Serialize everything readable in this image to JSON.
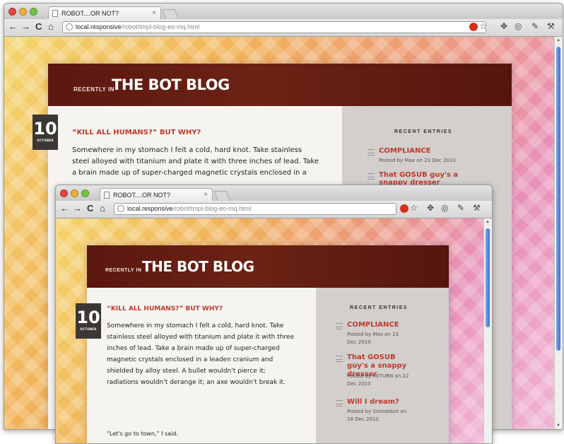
{
  "browser": {
    "tab_title": "ROBOT....OR NOT?",
    "tab_close": "×",
    "nav": {
      "back": "←",
      "forward": "→",
      "reload": "C",
      "home": "⌂"
    },
    "url_host": "local.responsive",
    "url_path": "/robot/tmpl-blog-eo-mq.html",
    "star": "☆"
  },
  "blog": {
    "masthead_small": "RECENTLY IN",
    "masthead_title": "THE BOT BLOG",
    "date_day": "10",
    "date_month": "OCTOBER",
    "post_title": "“KILL ALL HUMANS?” BUT WHY?",
    "post_paragraph": "Somewhere in my stomach I felt a cold, hard knot. Take stainless steel alloyed with titanium and plate it with three inches of lead. Take a brain made up of super-charged magnetic crystals enclosed in a leaden cranium and shielded by alloy steel. A bullet wouldn't pierce it; radiations wouldn't derange it; an axe wouldn't break it.",
    "post_quote": "“Let's go to town,” I said."
  },
  "sidebar": {
    "heading": "RECENT ENTRIES",
    "entries": [
      {
        "title": "COMPLIANCE",
        "meta": "Posted by Max on 23 Dec 2010"
      },
      {
        "title": "That GOSUB guy's a snappy dresser",
        "meta": "Posted by RETURN on 22 Dec 2010"
      },
      {
        "title": "Will I dream?",
        "meta": "Posted by Snoozebot on 18 Dec 2010"
      }
    ]
  },
  "colors": {
    "masthead": "#5b1710",
    "accent_red": "#c0392b",
    "sidebar_bg": "#d2cfcc"
  }
}
